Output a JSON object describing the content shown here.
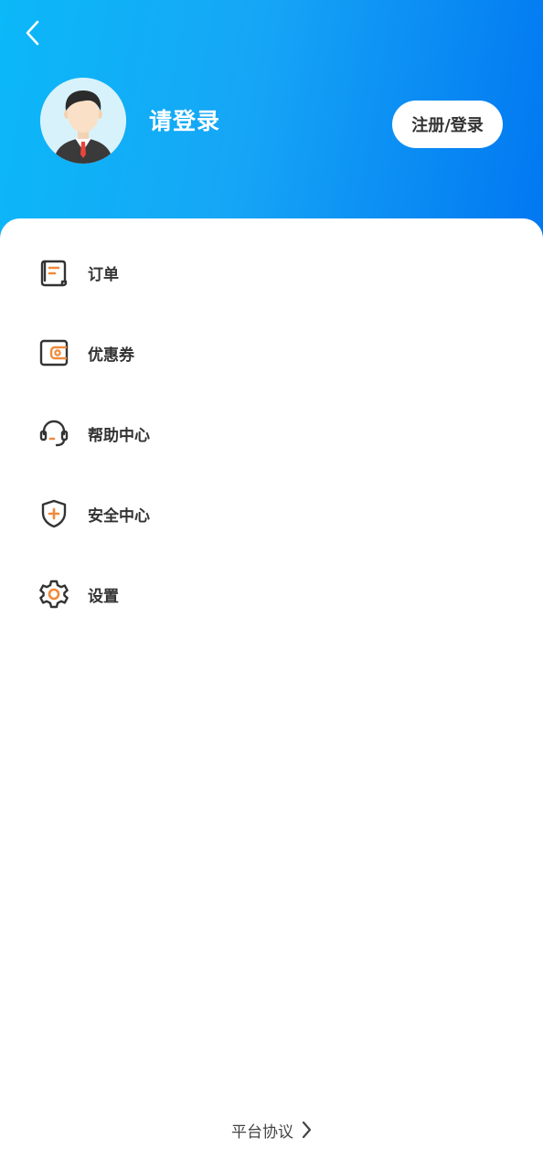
{
  "header": {
    "login_prompt": "请登录",
    "register_login_button": "注册/登录"
  },
  "menu": {
    "items": [
      {
        "label": "订单",
        "icon": "order-icon"
      },
      {
        "label": "优惠券",
        "icon": "coupon-icon"
      },
      {
        "label": "帮助中心",
        "icon": "headset-icon"
      },
      {
        "label": "安全中心",
        "icon": "shield-icon"
      },
      {
        "label": "设置",
        "icon": "gear-icon"
      }
    ]
  },
  "footer": {
    "platform_agreement": "平台协议"
  },
  "colors": {
    "header_gradient_start": "#0bb8f8",
    "header_gradient_end": "#0177f1",
    "icon_dark": "#333333",
    "icon_accent": "#f08a3c"
  }
}
